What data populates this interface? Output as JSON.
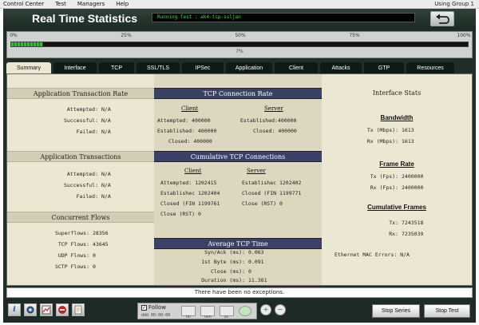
{
  "menubar": {
    "items": [
      "Control Center",
      "Test",
      "Managers",
      "Help"
    ],
    "group": "Using Group 1"
  },
  "header": {
    "title": "Real Time Statistics",
    "running_test": "Running Test : ak4-tcp-ssljan"
  },
  "progress": {
    "ticks": [
      "0%",
      "25%",
      "50%",
      "75%",
      "100%"
    ],
    "percent_label": "7%",
    "fraction": 0.07
  },
  "tabs": [
    {
      "label": "Summary",
      "active": true
    },
    {
      "label": "Interface"
    },
    {
      "label": "TCP"
    },
    {
      "label": "SSL/TLS"
    },
    {
      "label": "IPSec"
    },
    {
      "label": "Application"
    },
    {
      "label": "Client"
    },
    {
      "label": "Attacks"
    },
    {
      "label": "GTP"
    },
    {
      "label": "Resources"
    }
  ],
  "app_tx_rate": {
    "title": "Application Transaction Rate",
    "rows": [
      {
        "label": "Attempted:",
        "value": "N/A"
      },
      {
        "label": "Successful:",
        "value": "N/A"
      },
      {
        "label": "Failed:",
        "value": "N/A"
      }
    ]
  },
  "app_tx": {
    "title": "Application Transactions",
    "rows": [
      {
        "label": "Attempted:",
        "value": "N/A"
      },
      {
        "label": "Successful:",
        "value": "N/A"
      },
      {
        "label": "Failed:",
        "value": "N/A"
      }
    ]
  },
  "flows": {
    "title": "Concurrent Flows",
    "rows": [
      {
        "label": "Superflows:",
        "value": "28356"
      },
      {
        "label": "TCP Flows:",
        "value": "43645"
      },
      {
        "label": "UDP Flows:",
        "value": "0"
      },
      {
        "label": "SCTP Flows:",
        "value": "0"
      }
    ]
  },
  "tcp_rate": {
    "title": "TCP Connection Rate",
    "client_h": "Client",
    "server_h": "Server",
    "client": [
      {
        "label": "Attempted:",
        "value": "400000"
      },
      {
        "label": "Established:",
        "value": "400000"
      },
      {
        "label": "Closed:",
        "value": "400000"
      }
    ],
    "server": [
      {
        "label": "Established:",
        "value": "400000"
      },
      {
        "label": "Closed:",
        "value": "400000"
      }
    ]
  },
  "tcp_cum": {
    "title": "Cumulative TCP Connections",
    "client_h": "Client",
    "server_h": "Server",
    "client": [
      {
        "label": "Attempted:",
        "value": "1202415"
      },
      {
        "label": "Establishec",
        "value": "1202404"
      },
      {
        "label": "Closed (FIN",
        "value": "1199761"
      },
      {
        "label": "Close (RST)",
        "value": "0"
      }
    ],
    "server": [
      {
        "label": "Establishec",
        "value": "1202402"
      },
      {
        "label": "Closed (FIN",
        "value": "1199771"
      },
      {
        "label": "Close (RST)",
        "value": "0"
      }
    ]
  },
  "tcp_time": {
    "title": "Average TCP Time",
    "rows": [
      {
        "label": "Syn/Ack (ms):",
        "value": "0.063"
      },
      {
        "label": "1st Byte (ms):",
        "value": "0.091"
      },
      {
        "label": "Close (ms):",
        "value": "0"
      },
      {
        "label": "Duration (ms):",
        "value": "11.381"
      }
    ]
  },
  "iface": {
    "title": "Interface Stats",
    "bandwidth_h": "Bandwidth",
    "bandwidth": [
      {
        "label": "Tx (Mbps):",
        "value": "1613"
      },
      {
        "label": "Rx (Mbps):",
        "value": "1613"
      }
    ],
    "frame_h": "Frame Rate",
    "frame": [
      {
        "label": "Tx (Fps):",
        "value": "2400000"
      },
      {
        "label": "Rx (Fps):",
        "value": "2400000"
      }
    ],
    "cum_h": "Cumulative Frames",
    "cum": [
      {
        "label": "Tx:",
        "value": "7243518"
      },
      {
        "label": "Rx:",
        "value": "7235039"
      }
    ],
    "mac_label": "Ethernet MAC Errors:",
    "mac_value": "N/A"
  },
  "status_text": "There have been no exceptions.",
  "footer": {
    "follow_label": "Follow",
    "follow_sub": "ddd  00:00:00",
    "units": [
      "hh",
      "mm",
      "ss"
    ],
    "stop_series": "Stop Series",
    "stop_test": "Stop Test",
    "icons": [
      "info-icon",
      "settings-icon",
      "chart-icon",
      "stop-sign-icon",
      "notes-icon"
    ]
  }
}
